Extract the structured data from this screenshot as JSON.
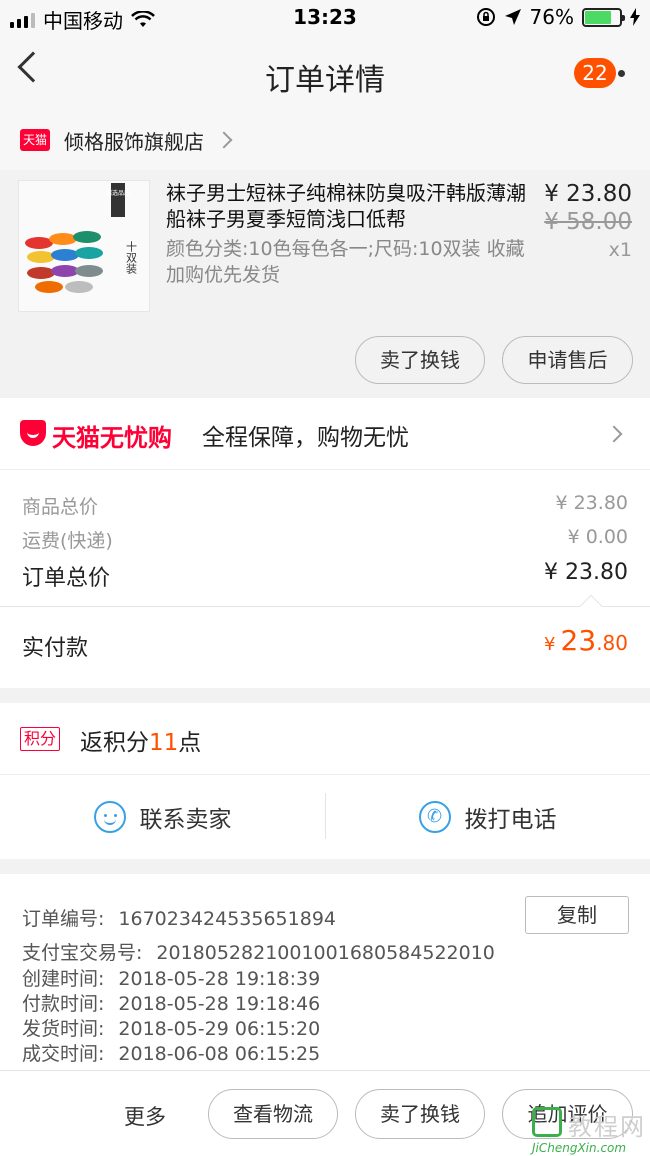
{
  "status_bar": {
    "carrier": "中国移动",
    "time": "13:23",
    "battery": "76%",
    "battery_level": 0.76,
    "icons": [
      "signal-icon",
      "wifi-icon",
      "orientation-lock-icon",
      "location-icon",
      "battery-icon",
      "charging-icon"
    ]
  },
  "nav": {
    "title": "订单详情",
    "badge_count": "22",
    "icons": [
      "back-icon",
      "more-icon"
    ]
  },
  "shop": {
    "tag": "天猫",
    "name": "倾格服饰旗舰店"
  },
  "product": {
    "title": "袜子男士短袜子纯棉袜防臭吸汗韩版薄潮船袜子男夏季短筒浅口低帮",
    "sku": "颜色分类:10色每色各一;尺码:10双装 收藏加购优先发货",
    "price": "¥ 23.80",
    "original_price": "¥ 58.00",
    "quantity": "x1",
    "thumbnail_text": "十双装",
    "thumbnail_label": "精选品质",
    "resell_button": "卖了换钱",
    "after_sale_button": "申请售后"
  },
  "worry_free": {
    "brand": "天猫无忧购",
    "text": "全程保障，购物无忧"
  },
  "summary": {
    "goods_label": "商品总价",
    "goods_value": "¥ 23.80",
    "shipping_label": "运费(快递)",
    "shipping_value": "¥ 0.00",
    "total_label": "订单总价",
    "total_value": "¥ 23.80",
    "paid_label": "实付款",
    "paid_currency": "¥",
    "paid_int": "23",
    "paid_dec": ".80"
  },
  "points": {
    "tag": "积分",
    "prefix": "返积分",
    "value": "11",
    "suffix": "点"
  },
  "contact": {
    "seller": "联系卖家",
    "phone": "拨打电话",
    "phone_glyph": "✆"
  },
  "order_info": {
    "order_no_label": "订单编号:",
    "order_no": "167023424535651894",
    "copy_button": "复制",
    "alipay_label": "支付宝交易号:",
    "alipay_no": "2018052821001001680584522010",
    "created_label": "创建时间:",
    "created": "2018-05-28 19:18:39",
    "paid_label": "付款时间:",
    "paid": "2018-05-28 19:18:46",
    "shipped_label": "发货时间:",
    "shipped": "2018-05-29 06:15:20",
    "done_label": "成交时间:",
    "done": "2018-06-08 06:15:25"
  },
  "bottom_bar": {
    "more": "更多",
    "logistics": "查看物流",
    "resell": "卖了换钱",
    "review": "追加评价"
  },
  "watermark": {
    "text": "教程网",
    "url": "JiChengXin.com"
  },
  "colors": {
    "accent": "#ff5000",
    "tmall_red": "#ff0036",
    "contact_blue": "#3aa0e6"
  }
}
